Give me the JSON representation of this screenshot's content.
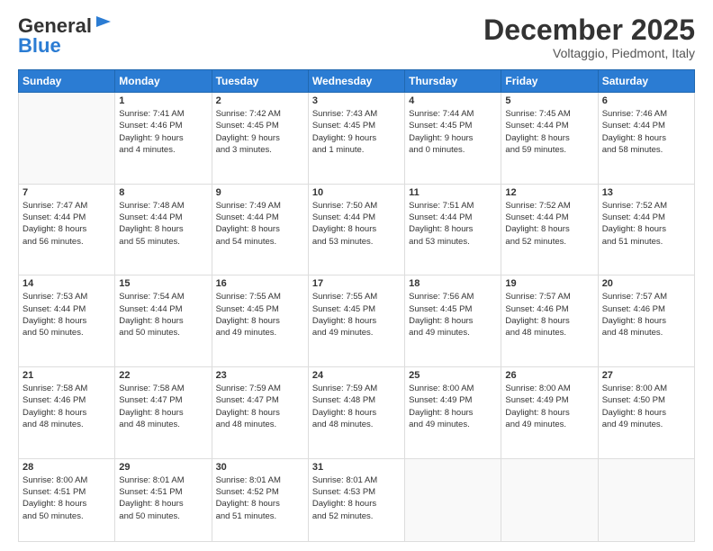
{
  "header": {
    "logo_line1": "General",
    "logo_line2": "Blue",
    "month": "December 2025",
    "location": "Voltaggio, Piedmont, Italy"
  },
  "weekdays": [
    "Sunday",
    "Monday",
    "Tuesday",
    "Wednesday",
    "Thursday",
    "Friday",
    "Saturday"
  ],
  "weeks": [
    [
      {
        "day": "",
        "info": ""
      },
      {
        "day": "1",
        "info": "Sunrise: 7:41 AM\nSunset: 4:46 PM\nDaylight: 9 hours\nand 4 minutes."
      },
      {
        "day": "2",
        "info": "Sunrise: 7:42 AM\nSunset: 4:45 PM\nDaylight: 9 hours\nand 3 minutes."
      },
      {
        "day": "3",
        "info": "Sunrise: 7:43 AM\nSunset: 4:45 PM\nDaylight: 9 hours\nand 1 minute."
      },
      {
        "day": "4",
        "info": "Sunrise: 7:44 AM\nSunset: 4:45 PM\nDaylight: 9 hours\nand 0 minutes."
      },
      {
        "day": "5",
        "info": "Sunrise: 7:45 AM\nSunset: 4:44 PM\nDaylight: 8 hours\nand 59 minutes."
      },
      {
        "day": "6",
        "info": "Sunrise: 7:46 AM\nSunset: 4:44 PM\nDaylight: 8 hours\nand 58 minutes."
      }
    ],
    [
      {
        "day": "7",
        "info": "Sunrise: 7:47 AM\nSunset: 4:44 PM\nDaylight: 8 hours\nand 56 minutes."
      },
      {
        "day": "8",
        "info": "Sunrise: 7:48 AM\nSunset: 4:44 PM\nDaylight: 8 hours\nand 55 minutes."
      },
      {
        "day": "9",
        "info": "Sunrise: 7:49 AM\nSunset: 4:44 PM\nDaylight: 8 hours\nand 54 minutes."
      },
      {
        "day": "10",
        "info": "Sunrise: 7:50 AM\nSunset: 4:44 PM\nDaylight: 8 hours\nand 53 minutes."
      },
      {
        "day": "11",
        "info": "Sunrise: 7:51 AM\nSunset: 4:44 PM\nDaylight: 8 hours\nand 53 minutes."
      },
      {
        "day": "12",
        "info": "Sunrise: 7:52 AM\nSunset: 4:44 PM\nDaylight: 8 hours\nand 52 minutes."
      },
      {
        "day": "13",
        "info": "Sunrise: 7:52 AM\nSunset: 4:44 PM\nDaylight: 8 hours\nand 51 minutes."
      }
    ],
    [
      {
        "day": "14",
        "info": "Sunrise: 7:53 AM\nSunset: 4:44 PM\nDaylight: 8 hours\nand 50 minutes."
      },
      {
        "day": "15",
        "info": "Sunrise: 7:54 AM\nSunset: 4:44 PM\nDaylight: 8 hours\nand 50 minutes."
      },
      {
        "day": "16",
        "info": "Sunrise: 7:55 AM\nSunset: 4:45 PM\nDaylight: 8 hours\nand 49 minutes."
      },
      {
        "day": "17",
        "info": "Sunrise: 7:55 AM\nSunset: 4:45 PM\nDaylight: 8 hours\nand 49 minutes."
      },
      {
        "day": "18",
        "info": "Sunrise: 7:56 AM\nSunset: 4:45 PM\nDaylight: 8 hours\nand 49 minutes."
      },
      {
        "day": "19",
        "info": "Sunrise: 7:57 AM\nSunset: 4:46 PM\nDaylight: 8 hours\nand 48 minutes."
      },
      {
        "day": "20",
        "info": "Sunrise: 7:57 AM\nSunset: 4:46 PM\nDaylight: 8 hours\nand 48 minutes."
      }
    ],
    [
      {
        "day": "21",
        "info": "Sunrise: 7:58 AM\nSunset: 4:46 PM\nDaylight: 8 hours\nand 48 minutes."
      },
      {
        "day": "22",
        "info": "Sunrise: 7:58 AM\nSunset: 4:47 PM\nDaylight: 8 hours\nand 48 minutes."
      },
      {
        "day": "23",
        "info": "Sunrise: 7:59 AM\nSunset: 4:47 PM\nDaylight: 8 hours\nand 48 minutes."
      },
      {
        "day": "24",
        "info": "Sunrise: 7:59 AM\nSunset: 4:48 PM\nDaylight: 8 hours\nand 48 minutes."
      },
      {
        "day": "25",
        "info": "Sunrise: 8:00 AM\nSunset: 4:49 PM\nDaylight: 8 hours\nand 49 minutes."
      },
      {
        "day": "26",
        "info": "Sunrise: 8:00 AM\nSunset: 4:49 PM\nDaylight: 8 hours\nand 49 minutes."
      },
      {
        "day": "27",
        "info": "Sunrise: 8:00 AM\nSunset: 4:50 PM\nDaylight: 8 hours\nand 49 minutes."
      }
    ],
    [
      {
        "day": "28",
        "info": "Sunrise: 8:00 AM\nSunset: 4:51 PM\nDaylight: 8 hours\nand 50 minutes."
      },
      {
        "day": "29",
        "info": "Sunrise: 8:01 AM\nSunset: 4:51 PM\nDaylight: 8 hours\nand 50 minutes."
      },
      {
        "day": "30",
        "info": "Sunrise: 8:01 AM\nSunset: 4:52 PM\nDaylight: 8 hours\nand 51 minutes."
      },
      {
        "day": "31",
        "info": "Sunrise: 8:01 AM\nSunset: 4:53 PM\nDaylight: 8 hours\nand 52 minutes."
      },
      {
        "day": "",
        "info": ""
      },
      {
        "day": "",
        "info": ""
      },
      {
        "day": "",
        "info": ""
      }
    ]
  ]
}
